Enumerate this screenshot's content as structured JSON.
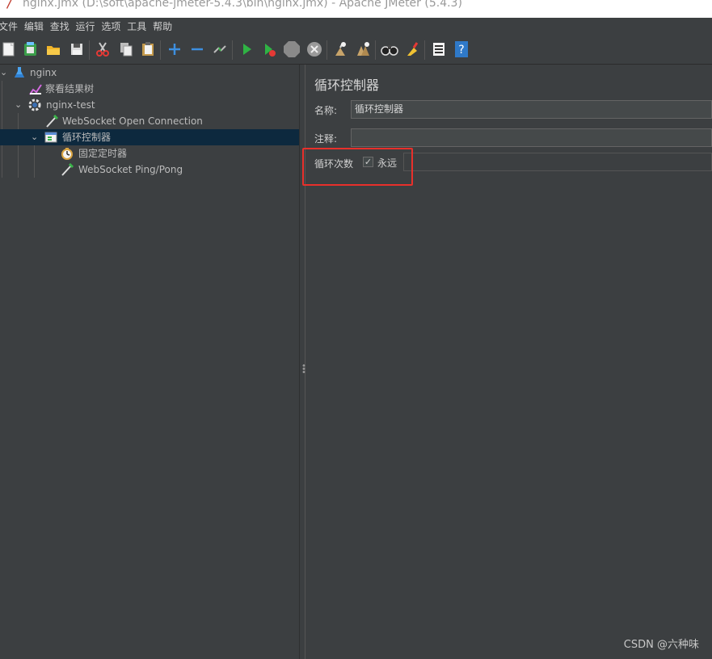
{
  "window": {
    "title": "nginx.jmx (D:\\soft\\apache-jmeter-5.4.3\\bin\\nginx.jmx) - Apache JMeter (5.4.3)"
  },
  "menu": {
    "items": [
      "文件",
      "编辑",
      "查找",
      "运行",
      "选项",
      "工具",
      "帮助"
    ]
  },
  "toolbar": {
    "buttons": [
      "new-icon",
      "templates-icon",
      "open-icon",
      "save-icon",
      "cut-icon",
      "copy-icon",
      "paste-icon",
      "expand-icon",
      "collapse-icon",
      "toggle-icon",
      "start-icon",
      "start-no-pause-icon",
      "stop-icon",
      "shutdown-icon",
      "clear-icon",
      "clear-all-icon",
      "search-icon",
      "reset-search-icon",
      "function-helper-icon",
      "help-icon"
    ]
  },
  "tree": {
    "nodes": [
      {
        "label": "nginx",
        "icon": "test-plan-icon",
        "expanded": true
      },
      {
        "label": "察看结果树",
        "icon": "listener-icon"
      },
      {
        "label": "nginx-test",
        "icon": "thread-group-icon",
        "expanded": true
      },
      {
        "label": "WebSocket Open Connection",
        "icon": "sampler-icon"
      },
      {
        "label": "循环控制器",
        "icon": "loop-controller-icon",
        "expanded": true,
        "selected": true
      },
      {
        "label": "固定定时器",
        "icon": "timer-icon"
      },
      {
        "label": "WebSocket Ping/Pong",
        "icon": "sampler-icon"
      }
    ]
  },
  "panel": {
    "title": "循环控制器",
    "name_label": "名称:",
    "name_value": "循环控制器",
    "comment_label": "注释:",
    "comment_value": "",
    "loop_label": "循环次数",
    "forever_label": "永远",
    "forever_checked": true,
    "loop_count_value": ""
  },
  "colors": {
    "background": "#3c3f41",
    "selection": "#0d293e",
    "highlight_box": "#e8302b"
  },
  "watermark": "CSDN @六种味"
}
